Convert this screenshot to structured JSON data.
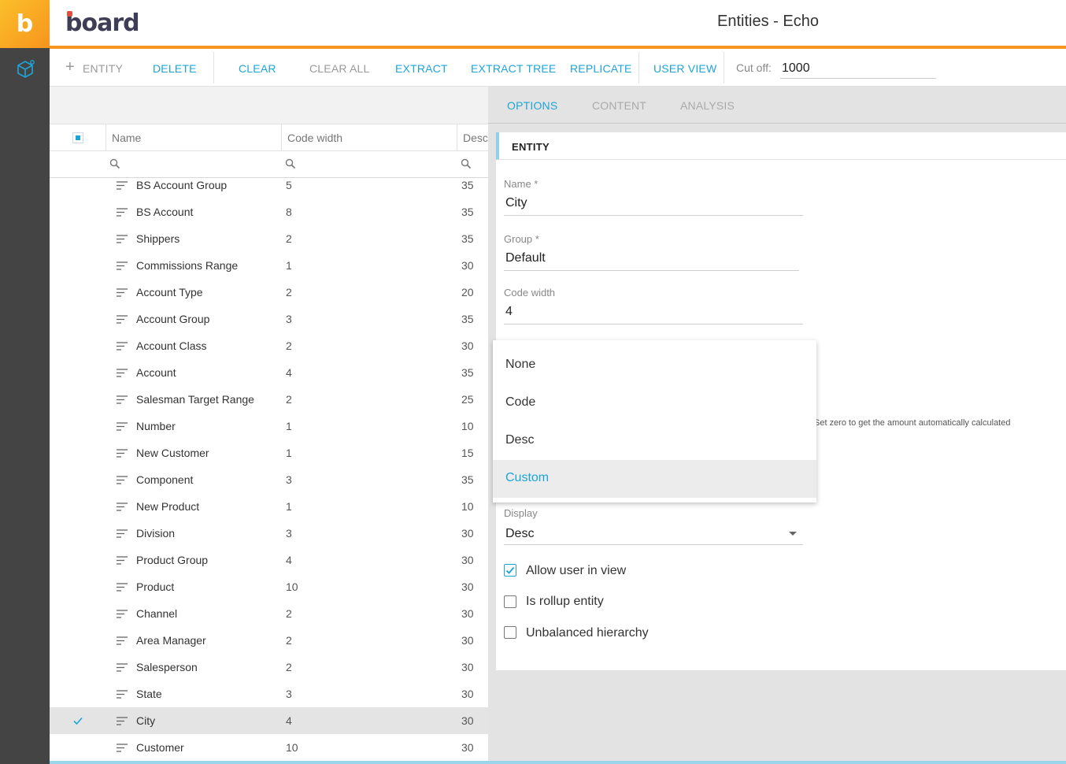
{
  "app": {
    "brand": "board",
    "title": "Entities - Echo"
  },
  "toolbar": {
    "entity": "ENTITY",
    "delete": "DELETE",
    "clear": "CLEAR",
    "clear_all": "CLEAR ALL",
    "extract": "EXTRACT",
    "extract_tree": "EXTRACT TREE",
    "replicate": "REPLICATE",
    "user_view": "USER VIEW",
    "cutoff_label": "Cut off:",
    "cutoff_value": "1000"
  },
  "table": {
    "columns": [
      "Name",
      "Code width",
      "Desc"
    ],
    "rows": [
      {
        "name": "BS Account Group",
        "code_width": "5",
        "desc": "35",
        "selected": false
      },
      {
        "name": "BS Account",
        "code_width": "8",
        "desc": "35",
        "selected": false
      },
      {
        "name": "Shippers",
        "code_width": "2",
        "desc": "35",
        "selected": false
      },
      {
        "name": "Commissions Range",
        "code_width": "1",
        "desc": "30",
        "selected": false
      },
      {
        "name": "Account Type",
        "code_width": "2",
        "desc": "20",
        "selected": false
      },
      {
        "name": "Account Group",
        "code_width": "3",
        "desc": "35",
        "selected": false
      },
      {
        "name": "Account Class",
        "code_width": "2",
        "desc": "30",
        "selected": false
      },
      {
        "name": "Account",
        "code_width": "4",
        "desc": "35",
        "selected": false
      },
      {
        "name": "Salesman Target Range",
        "code_width": "2",
        "desc": "25",
        "selected": false
      },
      {
        "name": "Number",
        "code_width": "1",
        "desc": "10",
        "selected": false
      },
      {
        "name": "New Customer",
        "code_width": "1",
        "desc": "15",
        "selected": false
      },
      {
        "name": "Component",
        "code_width": "3",
        "desc": "35",
        "selected": false
      },
      {
        "name": "New Product",
        "code_width": "1",
        "desc": "10",
        "selected": false
      },
      {
        "name": "Division",
        "code_width": "3",
        "desc": "30",
        "selected": false
      },
      {
        "name": "Product Group",
        "code_width": "4",
        "desc": "30",
        "selected": false
      },
      {
        "name": "Product",
        "code_width": "10",
        "desc": "30",
        "selected": false
      },
      {
        "name": "Channel",
        "code_width": "2",
        "desc": "30",
        "selected": false
      },
      {
        "name": "Area Manager",
        "code_width": "2",
        "desc": "30",
        "selected": false
      },
      {
        "name": "Salesperson",
        "code_width": "2",
        "desc": "30",
        "selected": false
      },
      {
        "name": "State",
        "code_width": "3",
        "desc": "30",
        "selected": false
      },
      {
        "name": "City",
        "code_width": "4",
        "desc": "30",
        "selected": true
      },
      {
        "name": "Customer",
        "code_width": "10",
        "desc": "30",
        "selected": false
      }
    ]
  },
  "tabs": [
    "OPTIONS",
    "CONTENT",
    "ANALYSIS"
  ],
  "active_tab": "OPTIONS",
  "panel": {
    "section_title": "ENTITY",
    "name_label": "Name *",
    "name_value": "City",
    "group_label": "Group *",
    "group_value": "Default",
    "code_width_label": "Code width",
    "code_width_value": "4",
    "hint": "Set zero to get the amount automatically calculated",
    "display_label": "Display",
    "display_value": "Desc",
    "allow_user_in_view": "Allow user in view",
    "allow_user_in_view_checked": true,
    "is_rollup": "Is rollup entity",
    "is_rollup_checked": false,
    "unbalanced": "Unbalanced hierarchy",
    "unbalanced_checked": false
  },
  "dropdown": {
    "options": [
      "None",
      "Code",
      "Desc",
      "Custom"
    ],
    "highlighted": "Custom"
  },
  "colors": {
    "accent": "#1ea5d8",
    "header_line": "#f7941d",
    "rail": "#444444"
  }
}
